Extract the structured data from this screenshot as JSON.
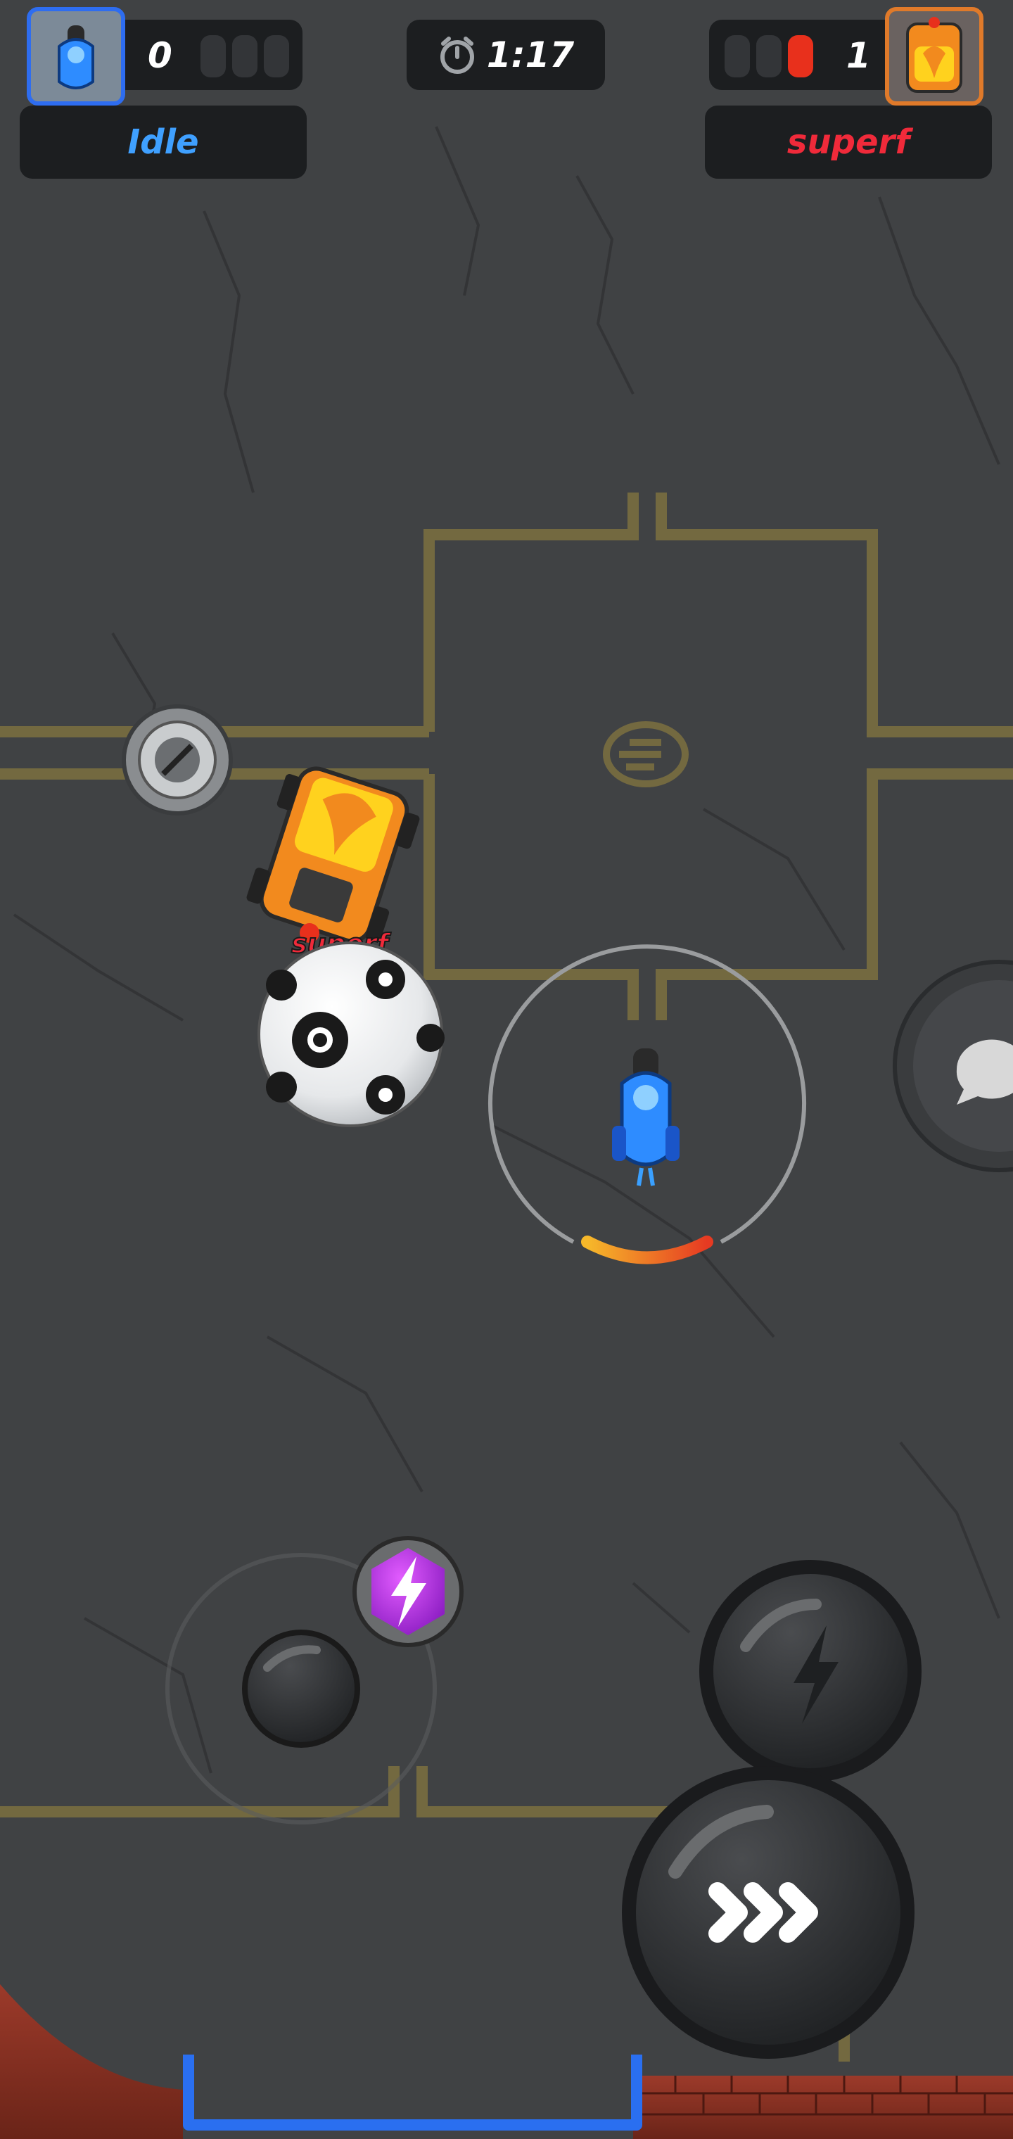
{
  "hud": {
    "player_left": {
      "name": "Idle",
      "score": "0",
      "name_color": "#3fa0ff",
      "frame_color": "#2e6df0"
    },
    "player_right": {
      "name": "superf",
      "score": "1",
      "name_color": "#f02a3a",
      "frame_color": "#e07a2a"
    },
    "timer": "1:17",
    "timer_icon": "stopwatch-icon"
  },
  "world": {
    "enemy_tag": "superf",
    "player_car_color": "#2e8cff",
    "enemy_car_color": "#f28a1e",
    "line_color": "#8a7a3c",
    "boost_meter_level": 0.4
  },
  "controls": {
    "chat_icon": "chat-bubble-icon",
    "boost_icon": "lightning-icon",
    "dash_icon": "triple-chevron-icon",
    "powerup_icon": "lightning-icon",
    "goal_color": "#2a6ff0"
  }
}
